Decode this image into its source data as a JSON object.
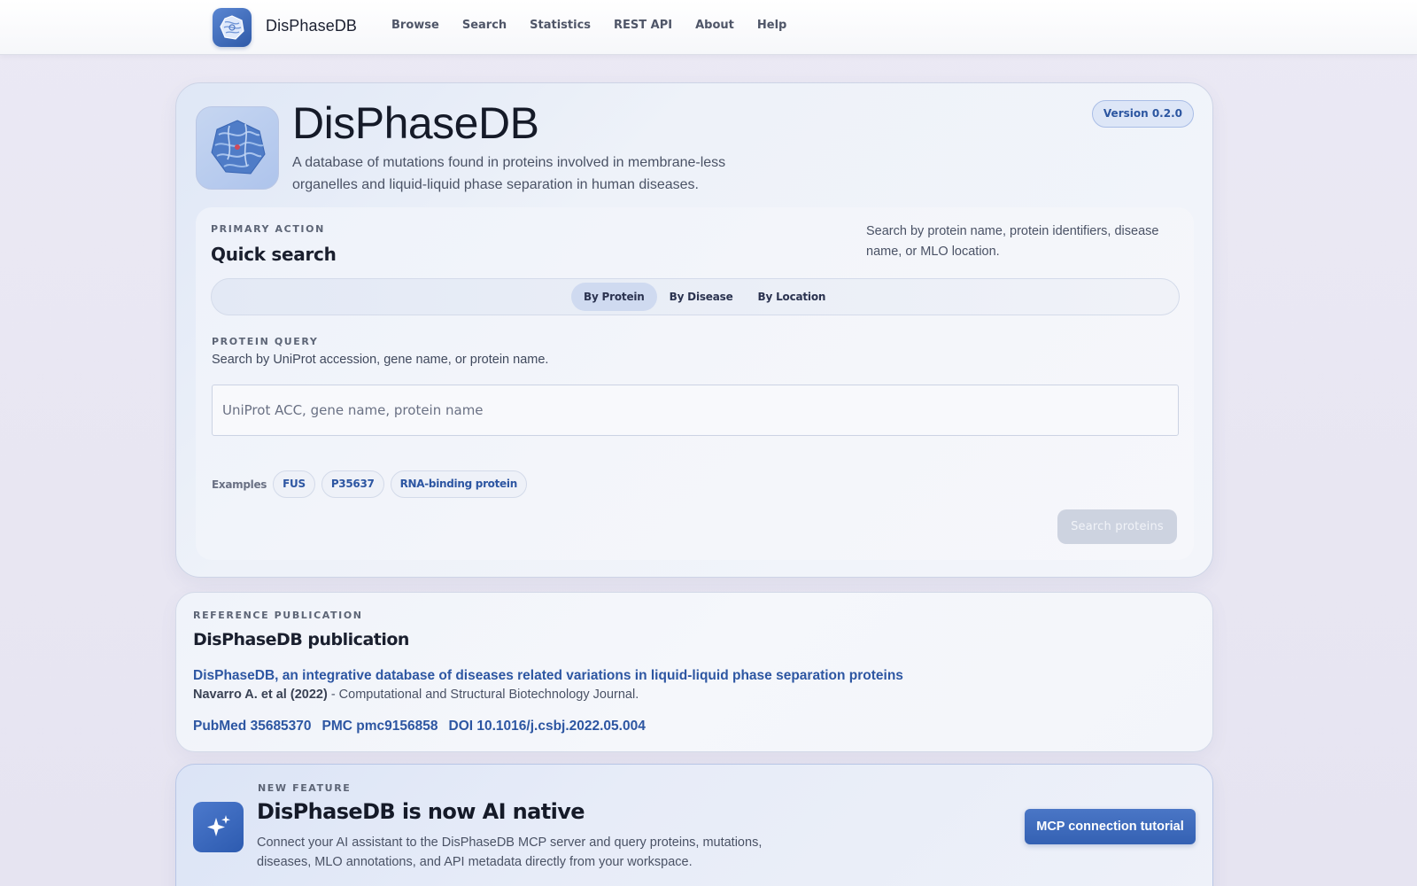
{
  "nav": {
    "brand": "DisPhaseDB",
    "links": [
      "Browse",
      "Search",
      "Statistics",
      "REST API",
      "About",
      "Help"
    ]
  },
  "hero": {
    "title": "DisPhaseDB",
    "subtitle": "A database of mutations found in proteins involved in membrane-less organelles and liquid-liquid phase separation in human diseases.",
    "version": "Version 0.2.0"
  },
  "search": {
    "eyebrow": "PRIMARY ACTION",
    "title": "Quick search",
    "hint": "Search by protein name, protein identifiers, disease name, or MLO location.",
    "tabs": [
      {
        "label": "By Protein",
        "active": true
      },
      {
        "label": "By Disease",
        "active": false
      },
      {
        "label": "By Location",
        "active": false
      }
    ],
    "query_eyebrow": "PROTEIN QUERY",
    "query_desc": "Search by UniProt accession, gene name, or protein name.",
    "input_value": "",
    "input_placeholder": "UniProt ACC, gene name, protein name",
    "examples_label": "Examples",
    "examples": [
      "FUS",
      "P35637",
      "RNA-binding protein"
    ],
    "submit_label": "Search proteins"
  },
  "publication": {
    "eyebrow": "REFERENCE PUBLICATION",
    "title": "DisPhaseDB publication",
    "article_title": "DisPhaseDB, an integrative database of diseases related variations in liquid-liquid phase separation proteins",
    "authors": "Navarro A. et al (2022)",
    "journal": " - Computational and Structural Biotechnology Journal.",
    "ids": [
      "PubMed 35685370",
      "PMC pmc9156858",
      "DOI 10.1016/j.csbj.2022.05.004"
    ]
  },
  "feature": {
    "eyebrow": "NEW FEATURE",
    "title": "DisPhaseDB is now AI native",
    "description": "Connect your AI assistant to the DisPhaseDB MCP server and query proteins, mutations, diseases, MLO annotations, and API metadata directly from your workspace.",
    "button": "MCP connection tutorial",
    "icon": "sparkles-icon"
  },
  "colors": {
    "accent": "#2d56a2",
    "button_primary": "#3d69ba",
    "button_disabled": "#cdd3e0"
  }
}
